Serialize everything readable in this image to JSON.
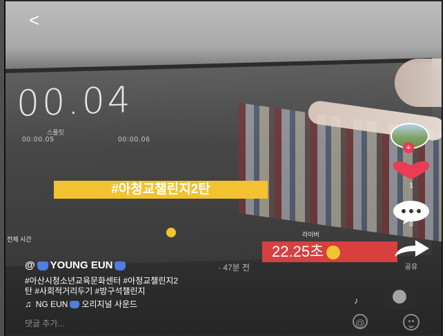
{
  "header": {
    "back_label": "<"
  },
  "video": {
    "timer": "00.04",
    "laps": [
      {
        "label": "스플릿",
        "value": "00:00.05"
      },
      {
        "label": "",
        "value": "00:00.06"
      }
    ],
    "bottom_left": "전체 시간",
    "bottom_right": "라이버",
    "hashtag_sticker": "#아청교챌린지2탄",
    "time_sticker": "22.25초"
  },
  "actions": {
    "like_count": "1",
    "comment_count": "0",
    "share_label": "공유"
  },
  "post": {
    "username_prefix": "@",
    "username": "YOUNG EUN",
    "time_ago": "· 47분 전",
    "caption_line1": "#아산시청소년교육문화센터 #아청교챌린지2",
    "caption_line2": "탄 #사회적거리두기 #방구석챌린지",
    "music_prefix": "NG EUN",
    "music_suffix": "오리지널 사운드"
  },
  "comment_bar": {
    "placeholder": "댓글 추가..."
  },
  "colors": {
    "like": "#ea3c53",
    "sticker_yellow": "#f2c230",
    "sticker_red": "#d84040",
    "accent_blue": "#4f7de0"
  },
  "icons": {
    "back": "chevron-left-icon",
    "like": "heart-icon",
    "comment": "speech-bubble-icon",
    "share": "share-arrow-icon",
    "music": "music-note-icon",
    "mention": "at-icon",
    "emoji": "smiley-icon"
  }
}
